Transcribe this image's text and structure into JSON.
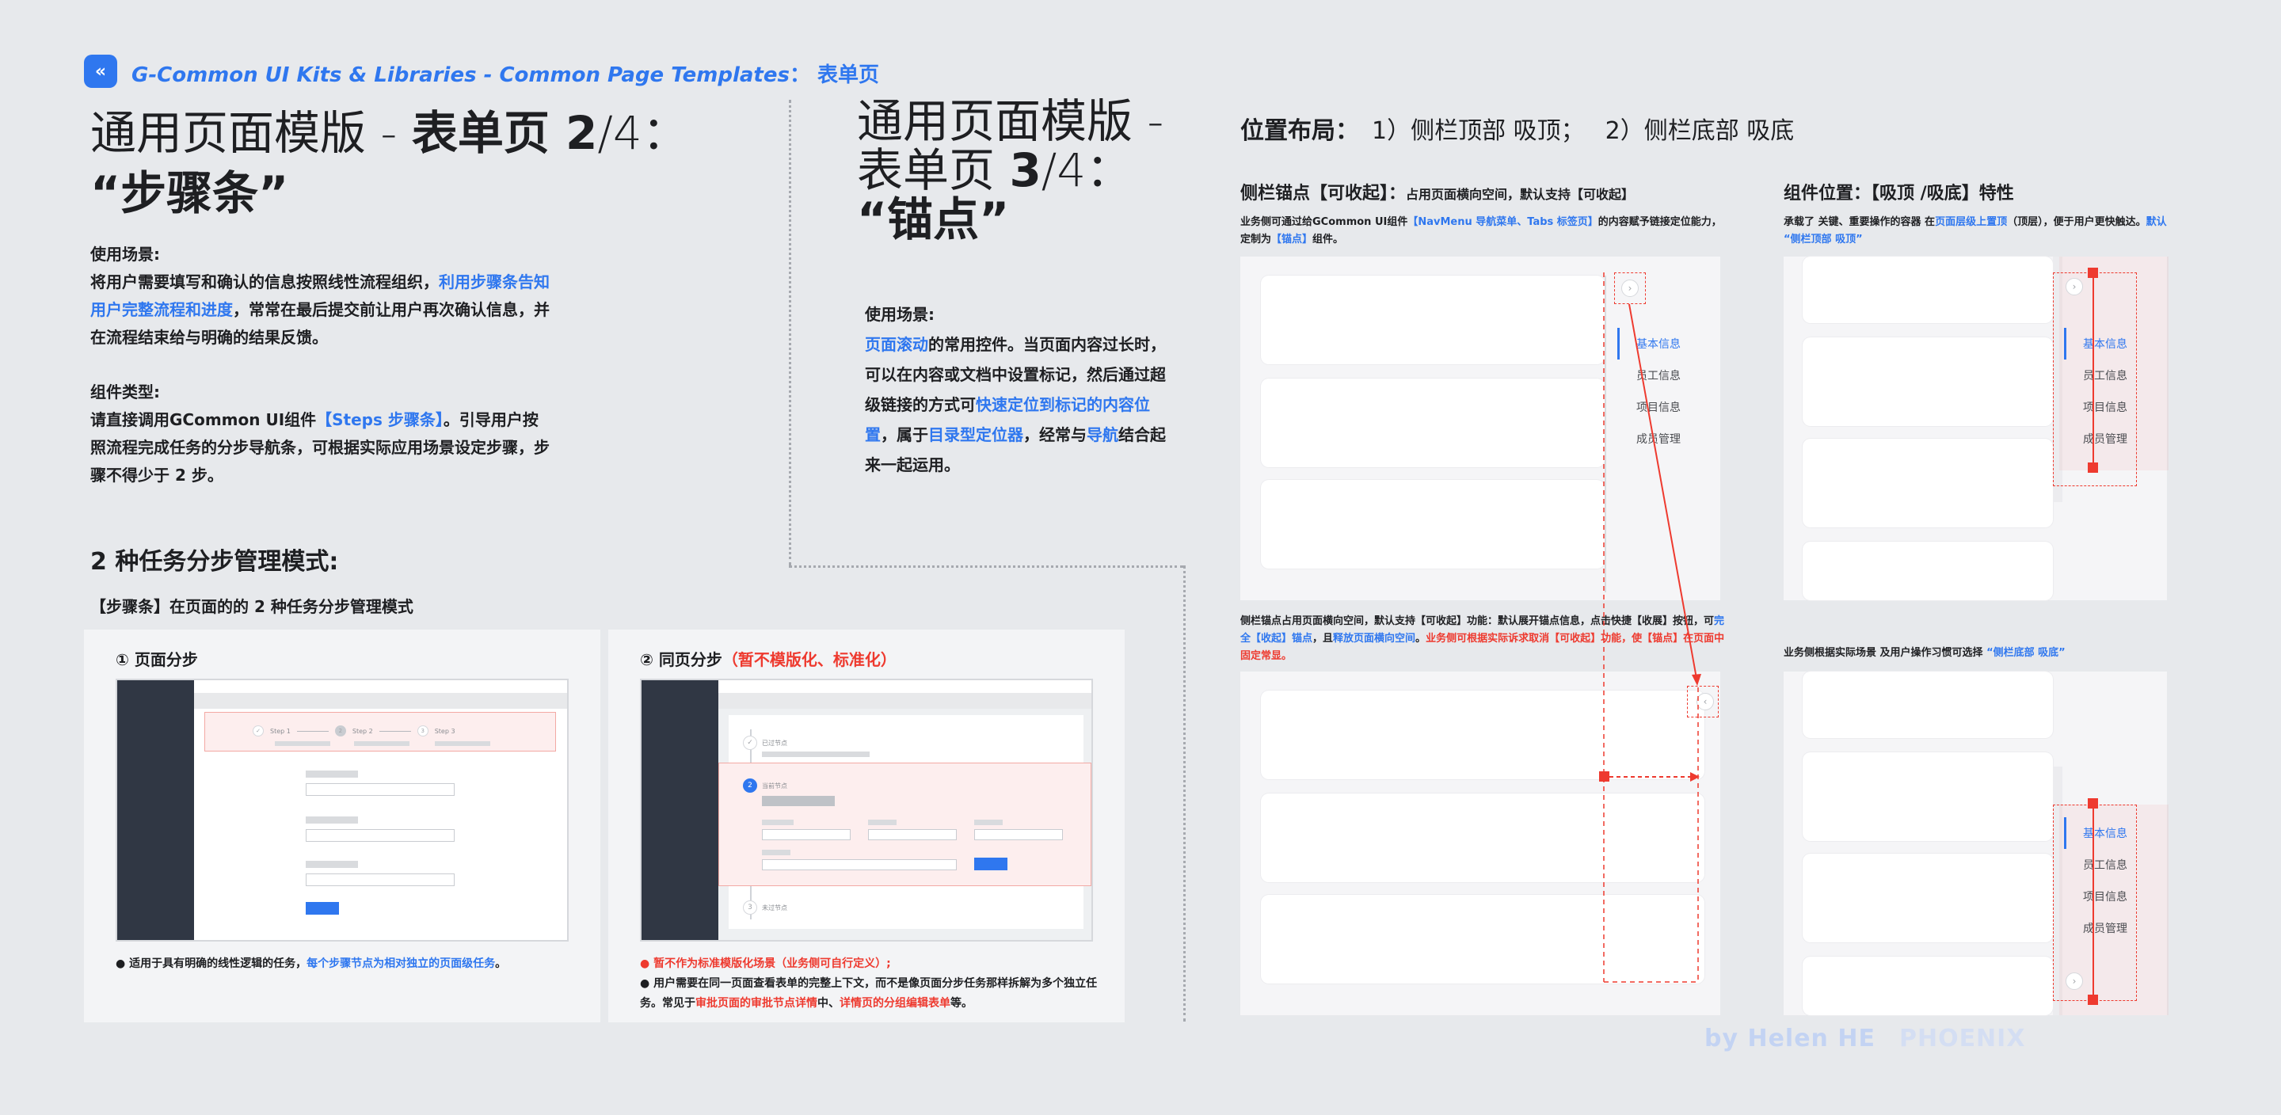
{
  "brand": {
    "logo_icon": "g-common-logo-icon",
    "title": "G-Common UI Kits & Libraries - Common Page Templates",
    "colon": "：",
    "page": "表单页"
  },
  "steps_section": {
    "title_pre": "通用页面模版 - ",
    "title_bold": "表单页 2",
    "title_post": "/4：",
    "title_line2": "“步骤条”",
    "usage_label": "使用场景:",
    "usage_t1": "将用户需要填写和确认的信息按照线性流程组织，",
    "usage_t2": "利用步骤条告知用户完整流程和进度",
    "usage_t3": "，常常在最后提交前让用户再次确认信息，并在流程结束给与明确的结果反馈。",
    "type_label": "组件类型:",
    "type_t1": "请直接调用GCommon UI组件",
    "type_t2": "【Steps 步骤条】",
    "type_t3": "。引导用户按照流程完成任务的分步导航条，可根据实际应用场景设定步骤，步骤不得少于 2 步。",
    "modes_title": "2 种任务分步管理模式:",
    "modes_subtitle": "【步骤条】在页面的的 2 种任务分步管理模式",
    "mode1": {
      "title": "① 页面分步",
      "steps": [
        "Step 1",
        "Step 2",
        "Step 3"
      ],
      "note_t1": "● 适用于具有明确的线性逻辑的任务，",
      "note_t2": "每个步骤节点为相对独立的页面级任务",
      "note_t3": "。"
    },
    "mode2": {
      "title": "② 同页分步",
      "title_red": "（暂不模版化、标准化）",
      "node_done": "已过节点",
      "node_current": "当前节点",
      "node_current_num": "2",
      "node_todo": "未过节点",
      "note_red": "● 暂不作为标准模版化场景（业务侧可自行定义）;",
      "note_t1": "● 用户需要在同一页面查看表单的完整上下文，而不是像页面分步任务那样拆解为多个独立任务。常见于",
      "note_t2": "审批页面的审批节点详情",
      "note_t3": "中、",
      "note_t4": "详情页的分组编辑表单",
      "note_t5": "等。"
    }
  },
  "anchor_section": {
    "title_l1": "通用页面模版 -",
    "title_l2_pre": "表单页 ",
    "title_l2_bold": "3",
    "title_l2_post": "/4：",
    "title_l3": "“锚点”",
    "usage_label": "使用场景:",
    "t1": "页面滚动",
    "t2": "的常用控件。当页面内容过长时，可以在内容或文档中设置标记，然后通过超级链接的方式可",
    "t3": "快速定位到标记的内容位置",
    "t4": "，属于",
    "t5": "目录型定位器",
    "t6": "，经常与",
    "t7": "导航",
    "t8": "结合起来一起运用。"
  },
  "layout_section": {
    "title": "位置布局：",
    "opt1": "1）侧栏顶部 吸顶；",
    "opt2": "2）侧栏底部 吸底",
    "collapse_title": "侧栏锚点【可收起】：",
    "collapse_sub": "占用页面横向空间，默认支持【可收起】",
    "collapse_desc_t1": "业务侧可通过给GCommon UI组件",
    "collapse_desc_t2": "【NavMenu 导航菜单、Tabs 标签页】",
    "collapse_desc_t3": "的内容赋予链接定位能力，定制为",
    "collapse_desc_t4": "【锚点】",
    "collapse_desc_t5": "组件。",
    "collapse_note_t1": "侧栏锚点占用页面横向空间，默认支持【可收起】功能：默认展开锚点信息，点击快捷【收展】按钮，可",
    "collapse_note_t2": "完全【收起】锚点",
    "collapse_note_t3": "，且",
    "collapse_note_t4": "释放页面横向空间",
    "collapse_note_t5": "。",
    "collapse_note_t6": "业务侧可根据实际诉求取消【可收起】功能，使【锚点】在页面中固定常显。",
    "pos_title": "组件位置：【吸顶 /吸底】特性",
    "pos_desc_t1": "承载了 关键、重要操作的容器 在",
    "pos_desc_t2": "页面层级上置顶",
    "pos_desc_t3": "（顶层），便于用户更快触达。",
    "pos_desc_t4": "默认 “侧栏顶部 吸顶”",
    "pos_note_t1": "业务侧根据实际场景 及用户操作习惯可选择 ",
    "pos_note_t2": "“侧栏底部 吸底”",
    "anchor_items": [
      "基本信息",
      "员工信息",
      "项目信息",
      "成员管理"
    ],
    "collapse_icon": "chevron-right-icon",
    "expand_icon": "chevron-left-icon"
  },
  "watermark": {
    "author": "by Helen HE",
    "brand": "PHOENIX"
  }
}
